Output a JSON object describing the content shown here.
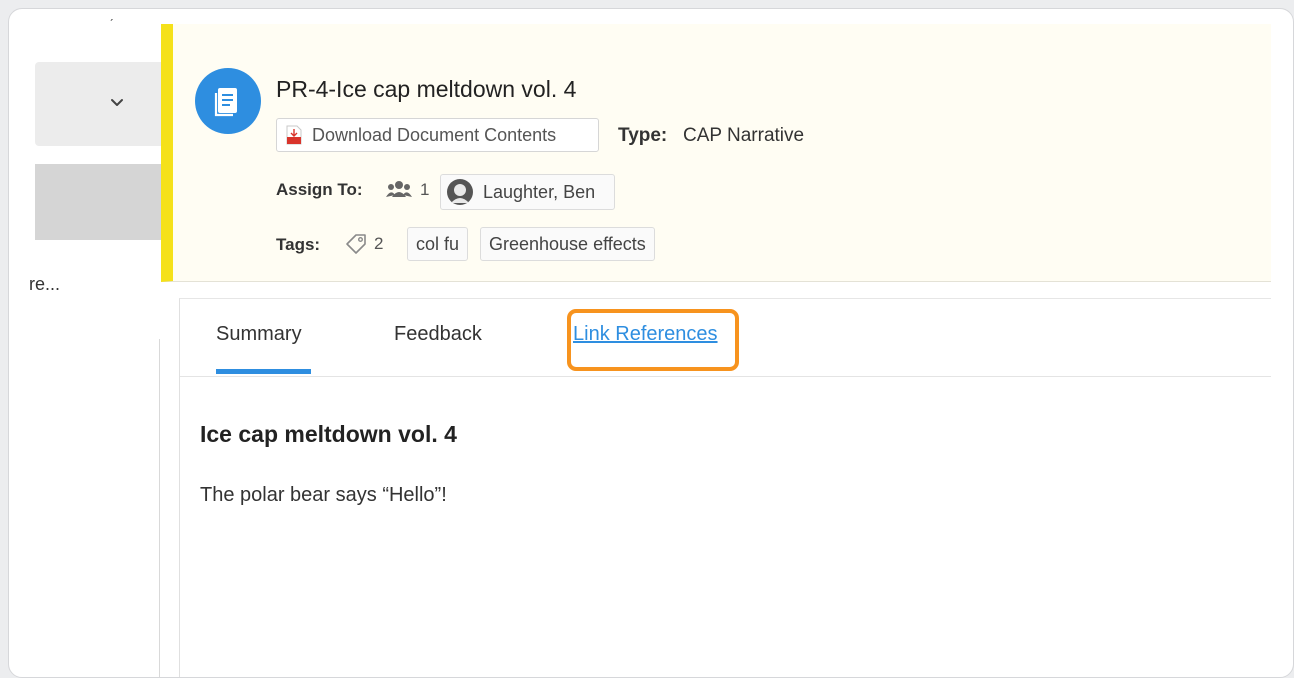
{
  "left": {
    "truncated_text": "re...",
    "top_tick": "ˏ"
  },
  "header": {
    "title": "PR-4-Ice cap meltdown vol. 4",
    "download_label": "Download Document Contents",
    "type_label": "Type:",
    "type_value": "CAP Narrative",
    "assign_label": "Assign To:",
    "assign_count": "1",
    "assignee": "Laughter, Ben",
    "tags_label": "Tags:",
    "tags_count": "2",
    "tags": [
      "col fu",
      "Greenhouse effects"
    ],
    "accent_color": "#f5e11a",
    "avatar_color": "#2e8ee0"
  },
  "tabs": [
    {
      "label": "Summary",
      "active": true
    },
    {
      "label": "Feedback",
      "active": false
    },
    {
      "label": "Link References",
      "active": false
    }
  ],
  "highlight_color": "#f7931e",
  "content": {
    "title": "Ice cap meltdown vol. 4",
    "body": "The polar bear says “Hello”!"
  },
  "icons": [
    "chevron-down-icon",
    "document-icon",
    "pdf-icon",
    "group-icon",
    "user-avatar-icon",
    "tag-icon"
  ]
}
